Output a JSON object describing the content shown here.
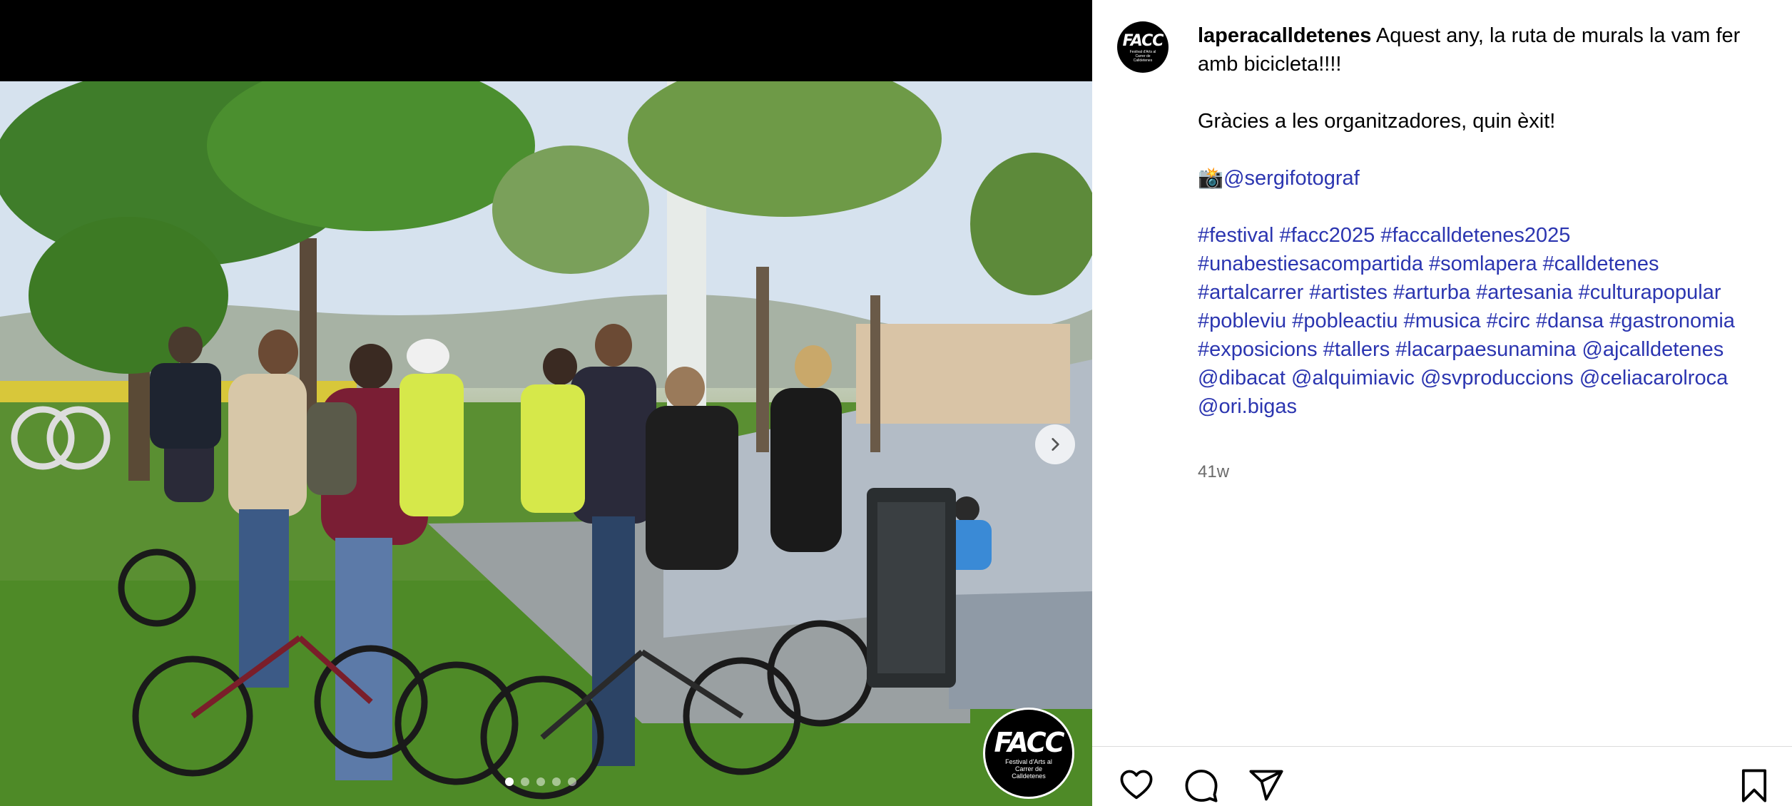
{
  "post": {
    "username": "laperacalldetenes",
    "caption_intro": " Aquest any, la ruta de murals la vam fer amb bicicleta!!!!",
    "caption_thanks": "Gràcies a les organitzadores, quin èxit!",
    "photo_credit_emoji": "📸",
    "photo_credit": "@sergifotograf",
    "tags": [
      "#festival",
      "#facc2025",
      "#faccalldetenes2025",
      "#unabestiesacompartida",
      "#somlapera",
      "#calldetenes",
      "#artalcarrer",
      "#artistes",
      "#arturba",
      "#artesania",
      "#culturapopular",
      "#pobleviu",
      "#pobleactiu",
      "#musica",
      "#circ",
      "#dansa",
      "#gastronomia",
      "#exposicions",
      "#tallers",
      "#lacarpaesunamina",
      "@ajcalldetenes",
      "@dibacat",
      "@alquimiavic",
      "@svproduccions",
      "@celiacarolroca",
      "@ori.bigas"
    ],
    "timestamp": "41w"
  },
  "avatar": {
    "title": "FACC",
    "subtitle": "Festival d'Arts al Carrer de Calldetenes"
  },
  "media": {
    "watermark_title": "FACC",
    "watermark_subtitle": "Festival d'Arts al Carrer de Calldetenes",
    "carousel_total": 5,
    "carousel_active": 1
  },
  "icons": {
    "next": "chevron-right-icon",
    "like": "heart-icon",
    "comment": "comment-icon",
    "share": "paper-plane-icon",
    "save": "bookmark-icon"
  },
  "colors": {
    "link": "#2b35b0",
    "timestamp": "#6b6b6b"
  }
}
